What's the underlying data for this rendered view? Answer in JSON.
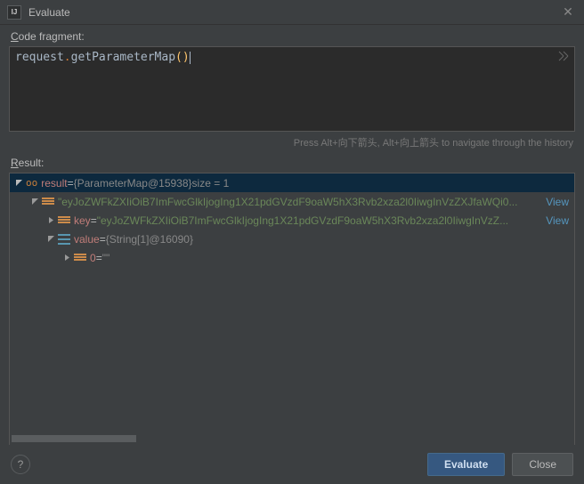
{
  "title": "Evaluate",
  "labels": {
    "code_fragment_prefix": "C",
    "code_fragment_rest": "ode fragment:",
    "result_prefix": "R",
    "result_rest": "esult:"
  },
  "code": {
    "identifier": "request",
    "method": "getParameterMap",
    "parens": "()"
  },
  "hint": "Press Alt+向下箭头, Alt+向上箭头 to navigate through the history",
  "tree": {
    "root": {
      "name": "result",
      "eq": " = ",
      "type": "{ParameterMap@15938} ",
      "size_label": " size = 1"
    },
    "entry": {
      "text": "\"eyJoZWFkZXIiOiB7ImFwcGlkIjogIng1X21pdGVzdF9oaW5hX3Rvb2xza2l0IiwgInVzZXJfaWQi0...",
      "view": "View"
    },
    "key": {
      "name": "key",
      "eq": " = ",
      "value": "\"eyJoZWFkZXIiOiB7ImFwcGlkIjogIng1X21pdGVzdF9oaW5hX3Rvb2xza2l0IiwgInVzZ...",
      "view": "View"
    },
    "value": {
      "name": "value",
      "eq": " = ",
      "type": "{String[1]@16090}"
    },
    "elem": {
      "idx": "0",
      "eq": " = ",
      "val": "\"\""
    }
  },
  "buttons": {
    "evaluate": "Evaluate",
    "close": "Close"
  }
}
